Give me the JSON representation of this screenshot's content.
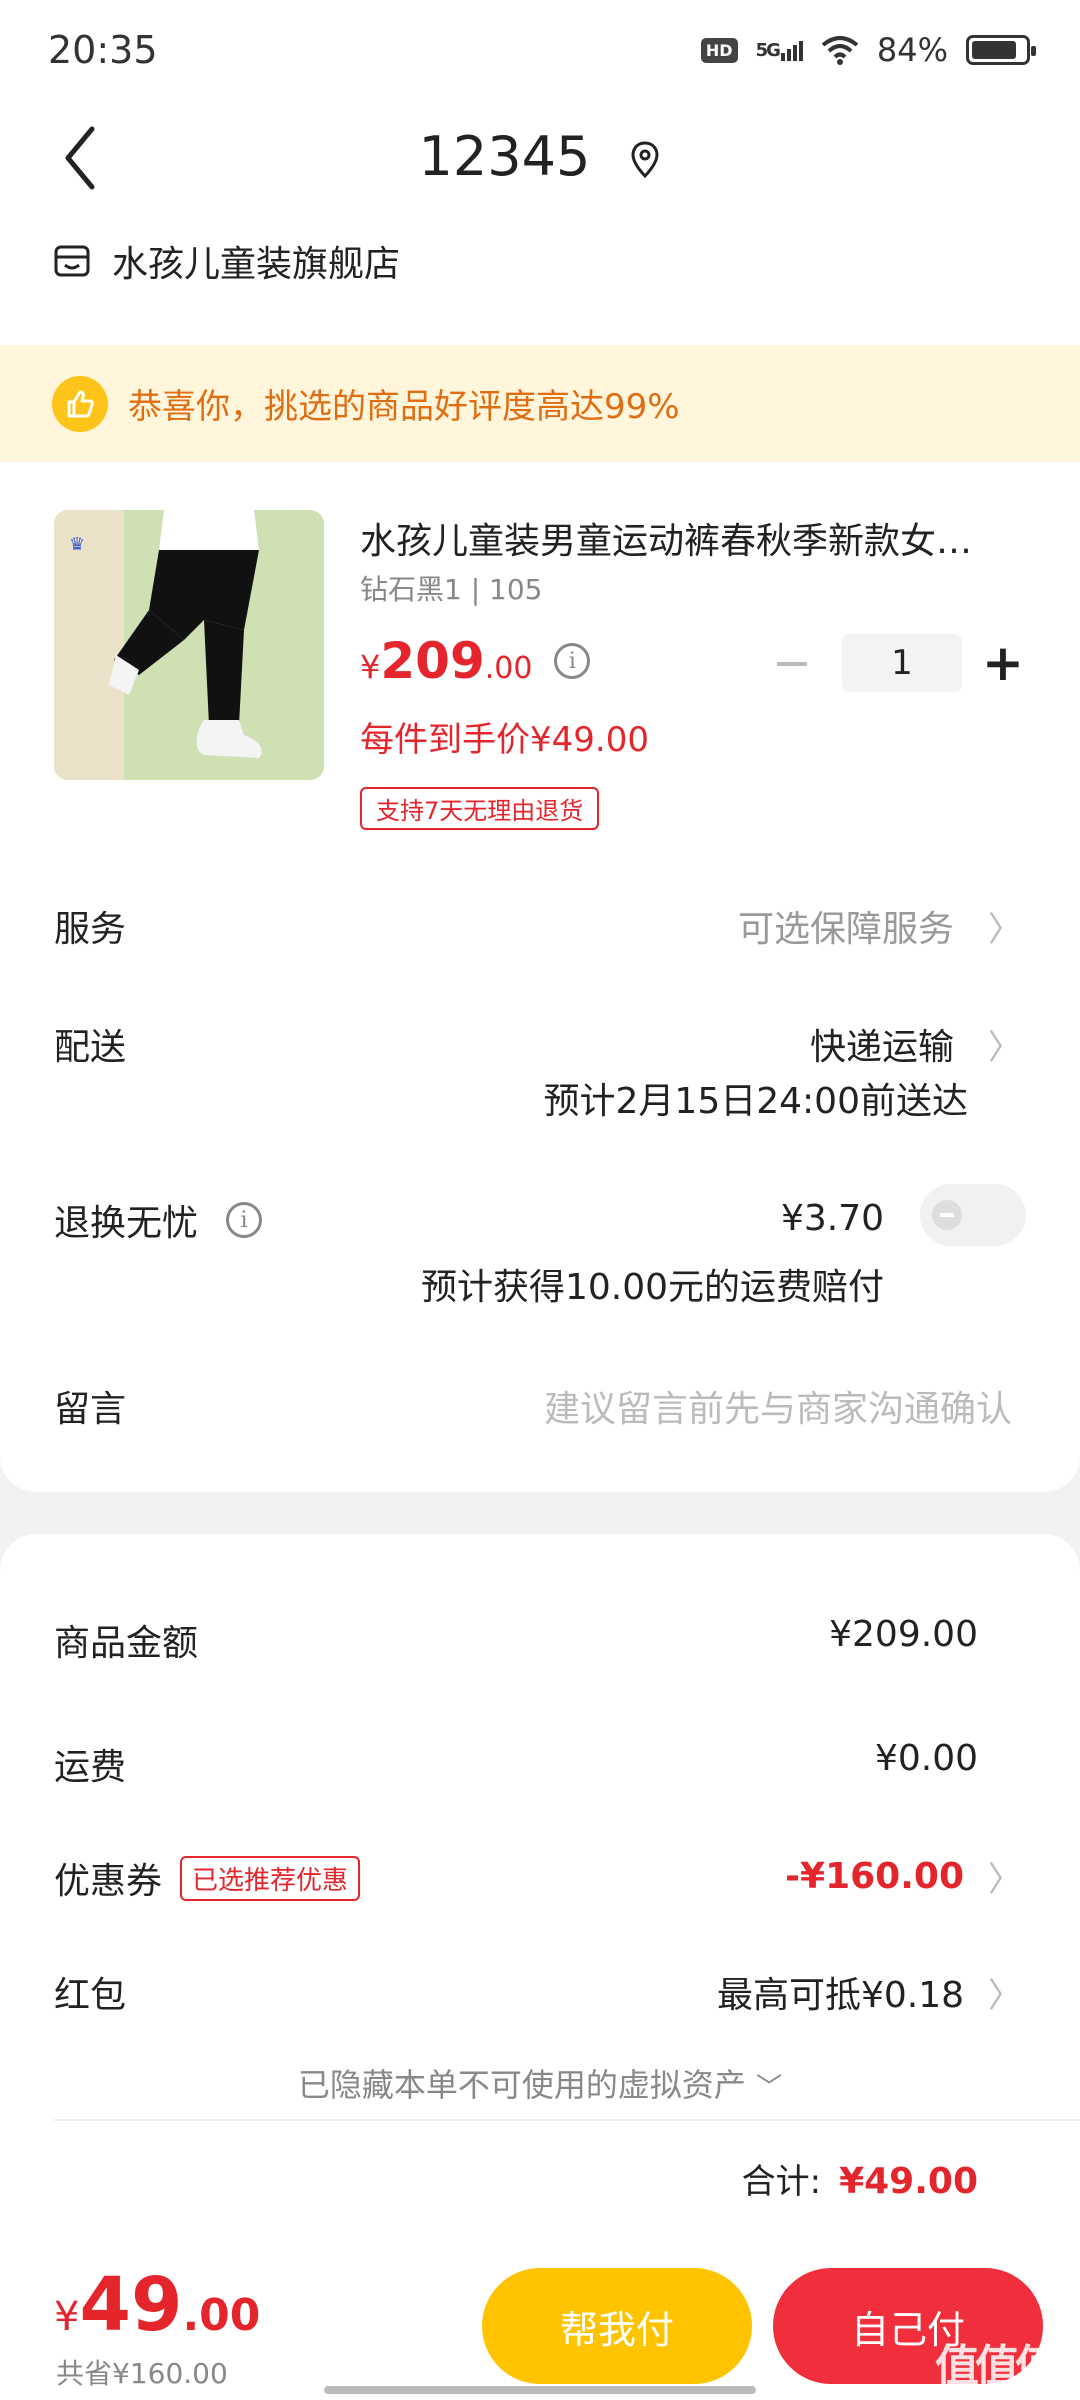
{
  "status_bar": {
    "time": "20:35",
    "network": "5G",
    "hd": "HD",
    "battery": "84%",
    "battery_level": 0.84
  },
  "header": {
    "title": "12345",
    "store_name": "水孩儿童装旗舰店"
  },
  "banner": {
    "text": "恭喜你，挑选的商品好评度高达99%"
  },
  "product": {
    "name": "水孩儿童装男童运动裤春秋季新款女…",
    "spec": "钻石黑1 | 105",
    "price_currency": "¥",
    "price_int": "209",
    "price_dec": ".00",
    "per_unit_price": "每件到手价¥49.00",
    "return_badge": "支持7天无理由退货",
    "quantity": "1",
    "minus": "−",
    "plus": "+"
  },
  "rows": {
    "service_label": "服务",
    "service_value": "可选保障服务",
    "delivery_label": "配送",
    "delivery_value": "快递运输",
    "delivery_eta": "预计2月15日24:00前送达",
    "return_label": "退换无忧",
    "return_price": "¥3.70",
    "return_note": "预计获得10.00元的运费赔付",
    "message_label": "留言",
    "message_placeholder": "建议留言前先与商家沟通确认"
  },
  "summary": {
    "goods_label": "商品金额",
    "goods_value": "¥209.00",
    "shipping_label": "运费",
    "shipping_value": "¥0.00",
    "coupon_label": "优惠券",
    "coupon_tag": "已选推荐优惠",
    "coupon_value": "-¥160.00",
    "redpacket_label": "红包",
    "redpacket_value": "最高可抵¥0.18",
    "hidden_assets": "已隐藏本单不可使用的虚拟资产",
    "total_label": "合计:",
    "total_value": "¥49.00"
  },
  "bottom": {
    "currency": "¥",
    "total_int": "49",
    "total_dec": ".00",
    "saved": "共省¥160.00",
    "help_pay": "帮我付",
    "self_pay": "自己付",
    "watermark": "值值值"
  },
  "colors": {
    "accent_red": "#e4262c",
    "accent_yellow": "#ffc300",
    "banner_bg": "#fff6dc"
  },
  "icons": [
    "back-arrow-icon",
    "location-pin-icon",
    "store-icon",
    "thumbs-up-icon",
    "info-icon",
    "chevron-right-icon",
    "chevron-down-icon"
  ]
}
